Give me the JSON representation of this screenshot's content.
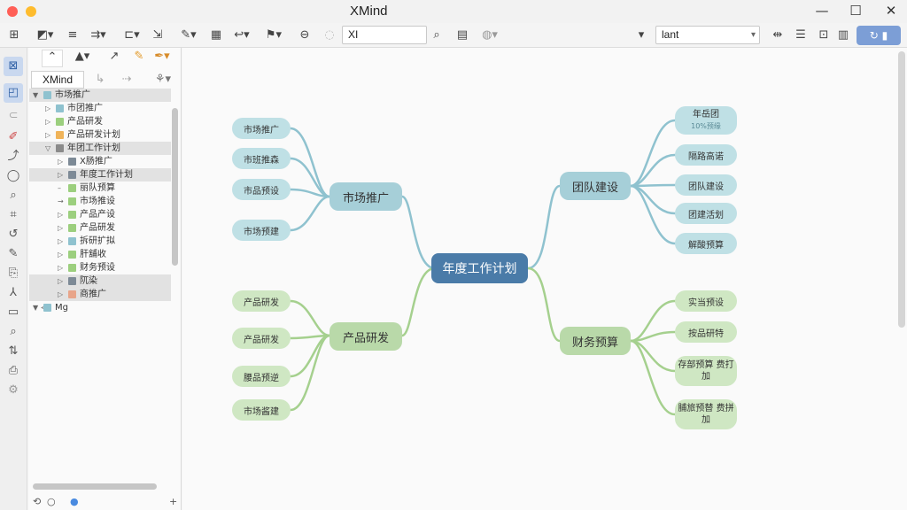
{
  "window": {
    "title": "XMind"
  },
  "toolbar": {
    "search_value": "XI",
    "font_value": "lant"
  },
  "panel": {
    "tab_label": "XMind",
    "tree": [
      {
        "label": "市场推广",
        "level": 0,
        "color": "#8fc2cf",
        "arrow": "▼",
        "selected": true
      },
      {
        "label": "市团推广",
        "level": 1,
        "color": "#8fc2cf",
        "arrow": "▷"
      },
      {
        "label": "产品研发",
        "level": 1,
        "color": "#9ccf7e",
        "arrow": "▷"
      },
      {
        "label": "产品研发计划",
        "level": 1,
        "color": "#f0b45a",
        "arrow": "▷"
      },
      {
        "label": "年团工作计划",
        "level": 1,
        "color": "#8a8a8a",
        "arrow": "▽",
        "selected": true
      },
      {
        "label": "X肠推广",
        "level": 2,
        "color": "#7d8a96",
        "arrow": "▷"
      },
      {
        "label": "年度工作计划",
        "level": 2,
        "color": "#7d8a96",
        "arrow": "▷",
        "selected": true
      },
      {
        "label": "丽队预算",
        "level": 2,
        "color": "#9ccf7e",
        "arrow": "–"
      },
      {
        "label": "市场推设",
        "level": 2,
        "color": "#9ccf7e",
        "arrow": "→"
      },
      {
        "label": "产品产设",
        "level": 2,
        "color": "#9ccf7e",
        "arrow": "▷"
      },
      {
        "label": "产品研发",
        "level": 2,
        "color": "#9ccf7e",
        "arrow": "▷"
      },
      {
        "label": "拆研扩拟",
        "level": 2,
        "color": "#8fc2cf",
        "arrow": "▷"
      },
      {
        "label": "肝舖收",
        "level": 2,
        "color": "#9ccf7e",
        "arrow": "▷"
      },
      {
        "label": "财务预设",
        "level": 2,
        "color": "#9ccf7e",
        "arrow": "▷"
      },
      {
        "label": "阢染",
        "level": 2,
        "color": "#7d8a96",
        "arrow": "▷",
        "selected": true
      },
      {
        "label": "商推广",
        "level": 2,
        "color": "#e8a58a",
        "arrow": "▷",
        "selected": true
      },
      {
        "label": "Mg",
        "level": 0,
        "color": "#8fc2cf",
        "arrow": "▼ <"
      }
    ],
    "footer_plus": "+"
  },
  "mindmap": {
    "root": "年度工作计划",
    "branches": {
      "market": {
        "label": "市场推广",
        "children": [
          "市场推广",
          "市班推森",
          "市品预设",
          "市场预建"
        ]
      },
      "product": {
        "label": "产品研发",
        "children": [
          "产品研发",
          "产品研发",
          "腰品预逆",
          "市场酱建"
        ]
      },
      "team": {
        "label": "团队建设",
        "children": [
          {
            "label": "年岳团",
            "sub": "10%预缘"
          },
          "隔路高诺",
          "团队建设",
          "团建活划",
          "解酸预算"
        ]
      },
      "finance": {
        "label": "财务预算",
        "children": [
          "实当预设",
          "按品研特",
          "存部预算 费打加",
          "脯旅预替 费拼加"
        ]
      }
    }
  }
}
